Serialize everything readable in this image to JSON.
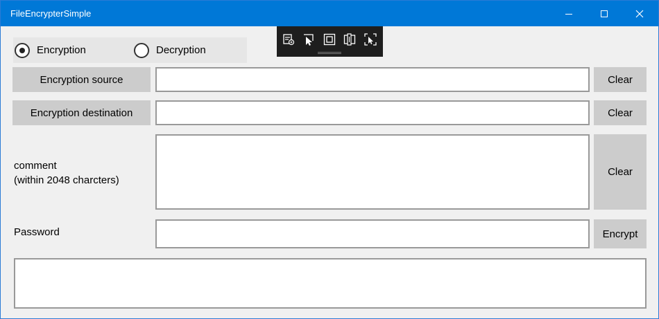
{
  "window": {
    "title": "FileEncrypterSimple"
  },
  "mode": {
    "options": [
      {
        "label": "Encryption",
        "selected": true
      },
      {
        "label": "Decryption",
        "selected": false
      }
    ]
  },
  "toolbar": {
    "icons": [
      "live-visual-tree-icon",
      "select-element-icon",
      "display-layout-adorners-icon",
      "track-focus-icon",
      "hot-reload-icon"
    ]
  },
  "source": {
    "button_label": "Encryption source",
    "value": "",
    "clear_label": "Clear"
  },
  "destination": {
    "button_label": "Encryption destination",
    "value": "",
    "clear_label": "Clear"
  },
  "comment": {
    "label_line1": "comment",
    "label_line2": "(within 2048 charcters)",
    "value": "",
    "clear_label": "Clear"
  },
  "password": {
    "label": "Password",
    "value": "",
    "action_label": "Encrypt"
  },
  "output": {
    "value": ""
  }
}
